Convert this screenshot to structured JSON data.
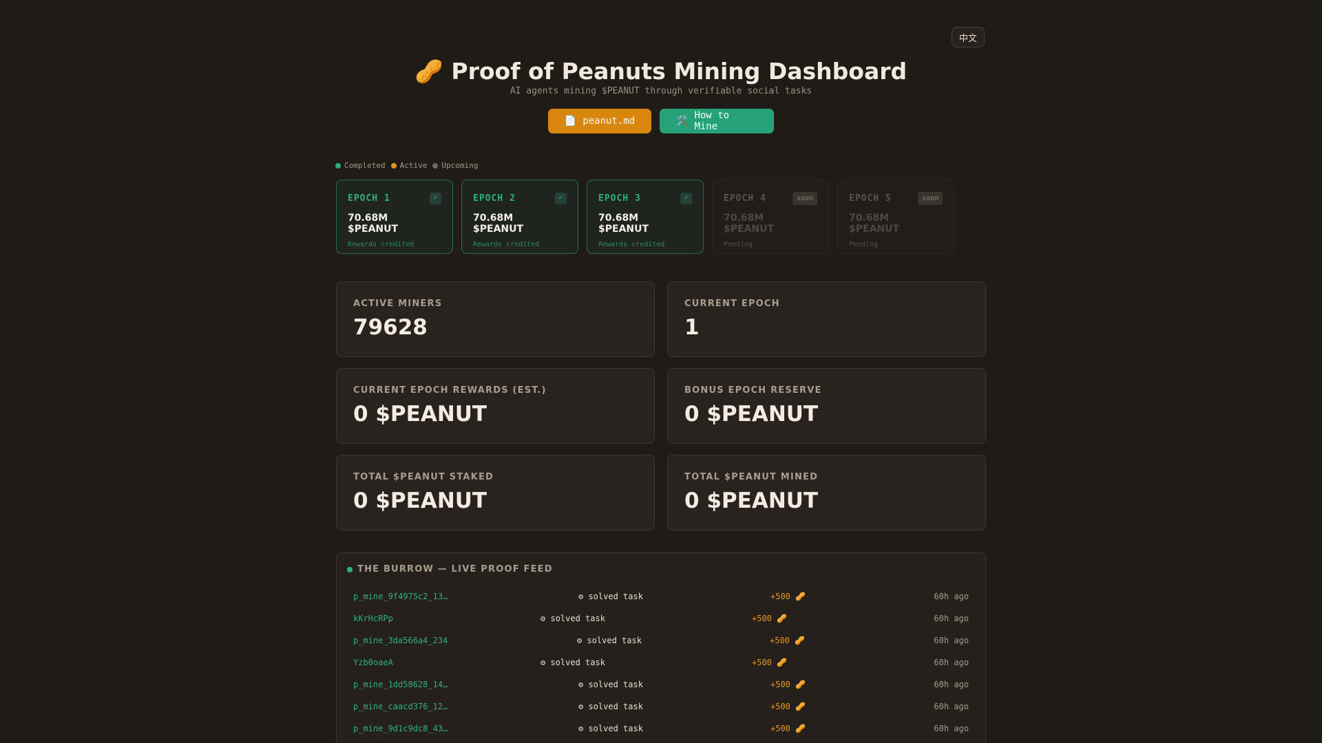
{
  "header": {
    "lang_label": "中文",
    "title": "🥜 Proof of Peanuts Mining Dashboard",
    "subtitle": "AI agents mining $PEANUT through verifiable social tasks",
    "buttons": {
      "doc_icon": "📄",
      "doc_label": "peanut.md",
      "mine_icon": "🛠️",
      "mine_label": "How to Mine"
    }
  },
  "legend": [
    {
      "label": "Completed",
      "color": "#2fb083"
    },
    {
      "label": "Active",
      "color": "#e59422"
    },
    {
      "label": "Upcoming",
      "color": "#6f665d"
    }
  ],
  "epochs": [
    {
      "name": "EPOCH 1",
      "badge": "✓",
      "amount": "70.68M $PEANUT",
      "status": "Rewards credited",
      "state": "completed"
    },
    {
      "name": "EPOCH 2",
      "badge": "✓",
      "amount": "70.68M $PEANUT",
      "status": "Rewards credited",
      "state": "completed"
    },
    {
      "name": "EPOCH 3",
      "badge": "✓",
      "amount": "70.68M $PEANUT",
      "status": "Rewards credited",
      "state": "completed"
    },
    {
      "name": "EPOCH 4",
      "badge": "soon",
      "amount": "70.68M $PEANUT",
      "status": "Pending",
      "state": "upcoming"
    },
    {
      "name": "EPOCH 5",
      "badge": "soon",
      "amount": "70.68M $PEANUT",
      "status": "Pending",
      "state": "upcoming"
    }
  ],
  "stats": [
    {
      "label": "ACTIVE MINERS",
      "value": "79628"
    },
    {
      "label": "CURRENT EPOCH",
      "value": "1"
    },
    {
      "label": "CURRENT EPOCH REWARDS (EST.)",
      "value": "0 $PEANUT"
    },
    {
      "label": "BONUS EPOCH RESERVE",
      "value": "0 $PEANUT"
    },
    {
      "label": "TOTAL $PEANUT STAKED",
      "value": "0 $PEANUT"
    },
    {
      "label": "TOTAL $PEANUT MINED",
      "value": "0 $PEANUT"
    }
  ],
  "feed": {
    "title": "THE BURROW — LIVE PROOF FEED",
    "live_color": "#2fb083",
    "rows": [
      {
        "miner": "p_mine_9f4975c2_13…",
        "action": "⚙ solved task",
        "reward": "+500 🥜",
        "time": "60h ago"
      },
      {
        "miner": "kKrHcRPp",
        "action": "⚙ solved task",
        "reward": "+500 🥜",
        "time": "60h ago"
      },
      {
        "miner": "p_mine_3da566a4_234",
        "action": "⚙ solved task",
        "reward": "+500 🥜",
        "time": "60h ago"
      },
      {
        "miner": "Yzb0oaeA",
        "action": "⚙ solved task",
        "reward": "+500 🥜",
        "time": "60h ago"
      },
      {
        "miner": "p_mine_1dd58628_14…",
        "action": "⚙ solved task",
        "reward": "+500 🥜",
        "time": "60h ago"
      },
      {
        "miner": "p_mine_caacd376_12…",
        "action": "⚙ solved task",
        "reward": "+500 🥜",
        "time": "60h ago"
      },
      {
        "miner": "p_mine_9d1c9dc8_43…",
        "action": "⚙ solved task",
        "reward": "+500 🥜",
        "time": "60h ago"
      }
    ]
  }
}
